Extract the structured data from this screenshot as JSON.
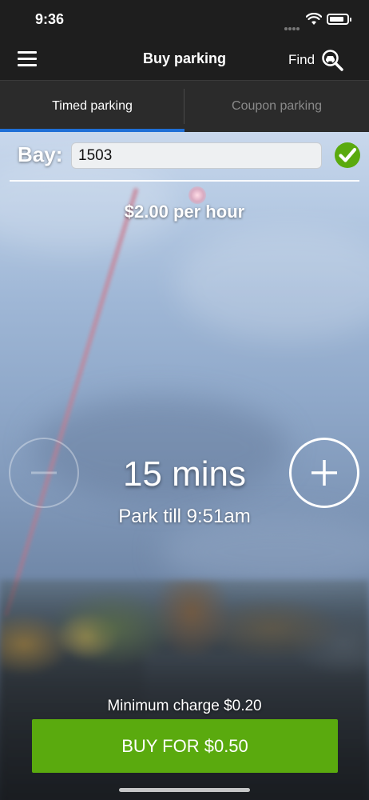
{
  "status_bar": {
    "time": "9:36",
    "battery_level": 0.85
  },
  "nav": {
    "title": "Buy parking",
    "find_label": "Find"
  },
  "tabs": [
    {
      "label": "Timed parking",
      "active": true
    },
    {
      "label": "Coupon parking",
      "active": false
    }
  ],
  "bay": {
    "label": "Bay:",
    "value": "1503",
    "valid": true
  },
  "rate": "$2.00 per hour",
  "duration": "15 mins",
  "park_till": "Park till 9:51am",
  "minimum_charge": "Minimum charge $0.20",
  "buy_button": "BUY FOR $0.50",
  "colors": {
    "accent_tab": "#1f6fd6",
    "buy_button": "#5aaa0e",
    "valid_check": "#5aaa0e",
    "bar_background": "#1e1e1e"
  },
  "icons": [
    "menu-icon",
    "car-search-icon",
    "checkmark-icon",
    "minus-icon",
    "plus-icon",
    "wifi-icon",
    "battery-icon",
    "signal-icon"
  ]
}
